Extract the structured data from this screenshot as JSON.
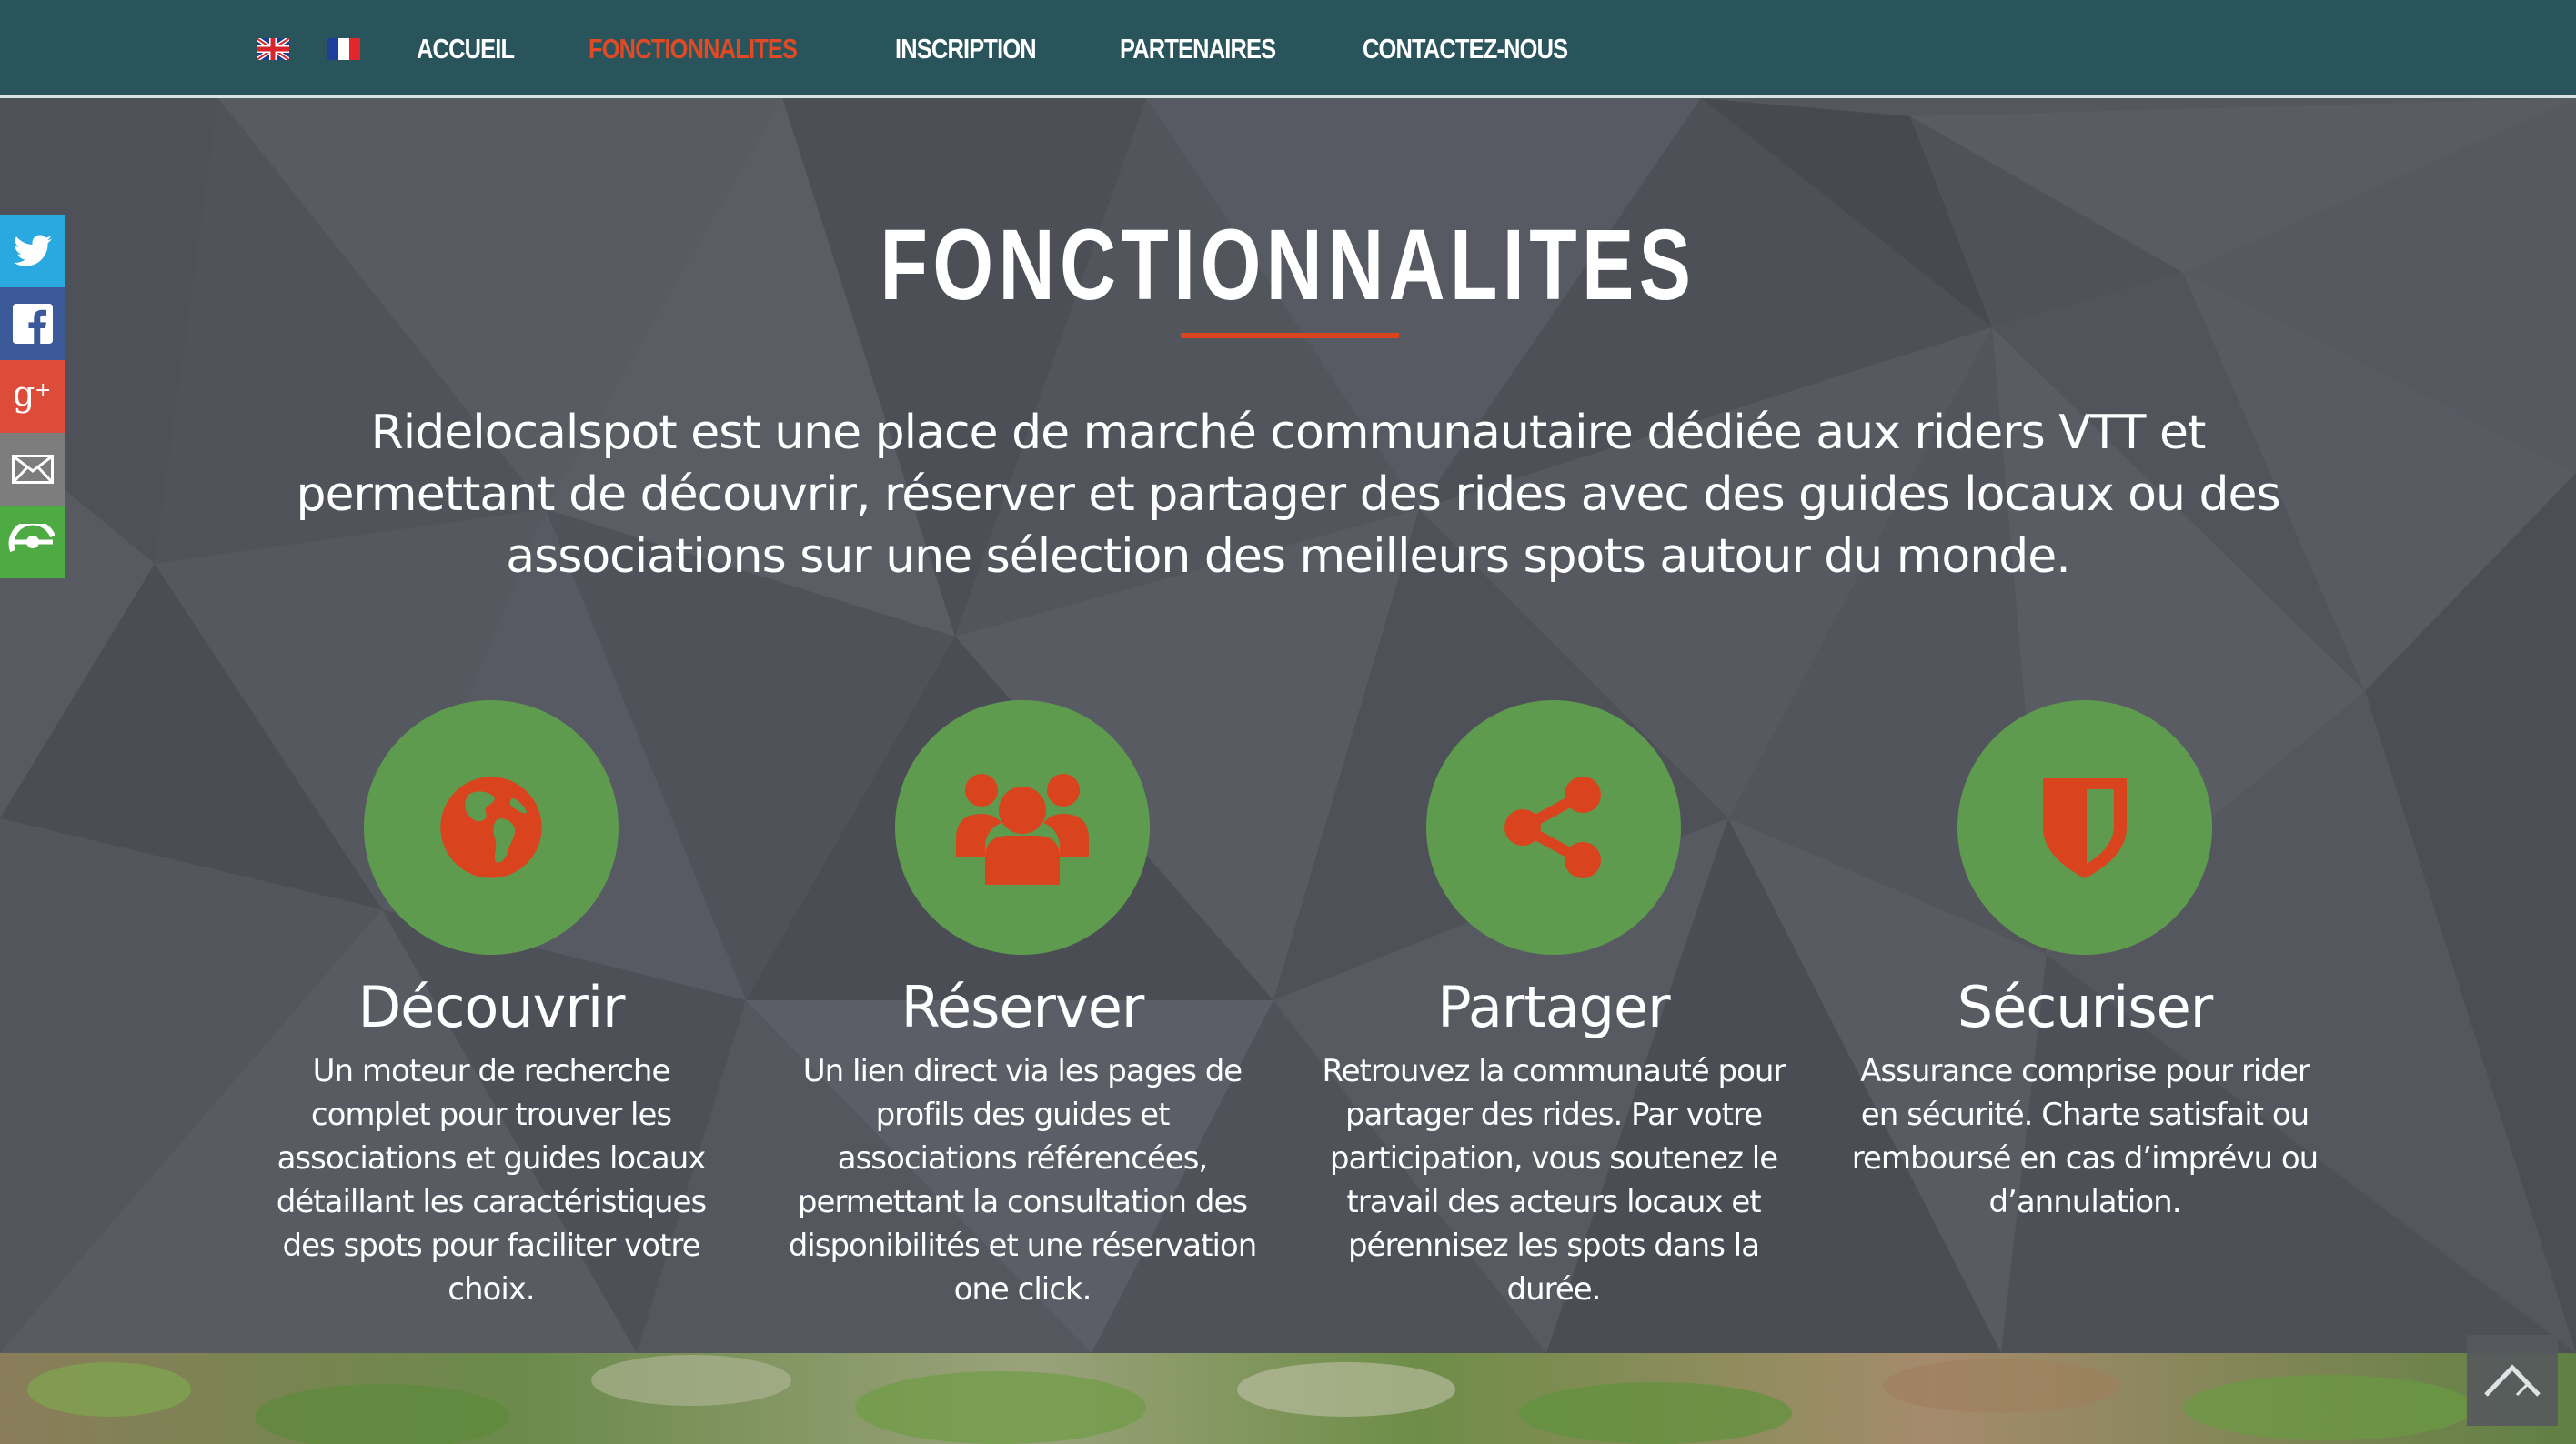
{
  "nav": {
    "languages": [
      {
        "icon": "uk-flag-icon",
        "label": "English"
      },
      {
        "icon": "france-flag-icon",
        "label": "Français"
      }
    ],
    "items": [
      {
        "label": "ACCUEIL",
        "active": false
      },
      {
        "label": "FONCTIONNALITES",
        "active": true
      },
      {
        "label": "INSCRIPTION",
        "active": false
      },
      {
        "label": "PARTENAIRES",
        "active": false
      },
      {
        "label": "CONTACTEZ-NOUS",
        "active": false
      }
    ]
  },
  "social": [
    {
      "icon": "twitter-icon",
      "color": "#2aa9e0"
    },
    {
      "icon": "facebook-icon",
      "color": "#3b5998"
    },
    {
      "icon": "google-plus-icon",
      "color": "#dd4b39"
    },
    {
      "icon": "email-icon",
      "color": "#7d7d7d"
    },
    {
      "icon": "share-icon",
      "color": "#4eaa43"
    }
  ],
  "section": {
    "title": "FONCTIONNALITES",
    "intro": "Ridelocalspot est une place de marché communautaire dédiée aux riders VTT et permettant de découvrir, réserver et partager des rides avec des guides locaux ou des associations sur une sélection des meilleurs spots autour du monde."
  },
  "features": [
    {
      "icon": "globe-icon",
      "title": "Découvrir",
      "description": "Un moteur de recherche complet pour trouver les associations et guides locaux détaillant les caractéristiques des spots pour faciliter votre choix."
    },
    {
      "icon": "users-icon",
      "title": "Réserver",
      "description": "Un lien direct via les pages de profils des guides et associations référencées, permettant la consultation des disponibilités et une réservation one click."
    },
    {
      "icon": "share-nodes-icon",
      "title": "Partager",
      "description": "Retrouvez la communauté pour partager des rides. Par votre participation, vous soutenez le travail des acteurs locaux et pérennisez les spots dans la durée."
    },
    {
      "icon": "shield-icon",
      "title": "Sécuriser",
      "description": "Assurance comprise pour rider en sécurité. Charte satisfait ou remboursé en cas d’imprévu ou d’annulation."
    }
  ],
  "colors": {
    "nav_bg": "#29545b",
    "accent": "#d9431d",
    "feature_circle": "#5f9b4f",
    "section_bg": "#55585f"
  },
  "back_to_top": {
    "icon": "chevron-up-icon"
  }
}
